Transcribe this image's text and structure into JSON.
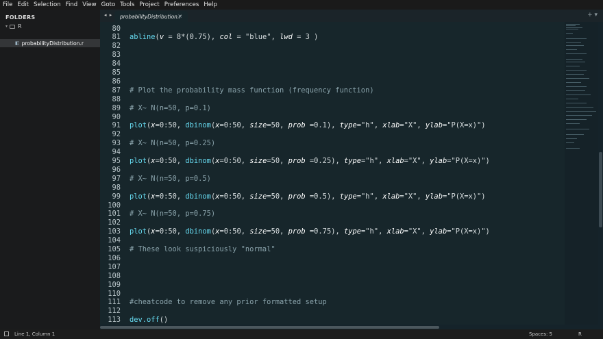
{
  "menu": [
    "File",
    "Edit",
    "Selection",
    "Find",
    "View",
    "Goto",
    "Tools",
    "Project",
    "Preferences",
    "Help"
  ],
  "sidebar": {
    "title": "FOLDERS",
    "folder": {
      "arrow": "▾",
      "name": "R"
    },
    "file": {
      "glyph": "◧",
      "name": "probabilityDistribution.r"
    }
  },
  "tabbar": {
    "nav": "◂ ▸",
    "tab_label": "probabilityDistribution.r",
    "close": "×",
    "actions": "+ ▾"
  },
  "editor": {
    "lines": [
      {
        "n": "80",
        "segs": []
      },
      {
        "n": "81",
        "segs": [
          [
            "fn",
            "abline"
          ],
          [
            "op",
            "("
          ],
          [
            "arg",
            "v"
          ],
          [
            "op",
            " = "
          ],
          [
            "num",
            "8"
          ],
          [
            "op",
            "*("
          ],
          [
            "num",
            "0.75"
          ],
          [
            "op",
            "), "
          ],
          [
            "arg",
            "col"
          ],
          [
            "op",
            " = "
          ],
          [
            "str",
            "\"blue\""
          ],
          [
            "op",
            ", "
          ],
          [
            "arg",
            "lwd"
          ],
          [
            "op",
            " = "
          ],
          [
            "num",
            "3"
          ],
          [
            "op",
            " )"
          ]
        ]
      },
      {
        "n": "82",
        "segs": []
      },
      {
        "n": "83",
        "segs": []
      },
      {
        "n": "84",
        "segs": []
      },
      {
        "n": "85",
        "segs": []
      },
      {
        "n": "86",
        "segs": []
      },
      {
        "n": "87",
        "segs": [
          [
            "cm",
            "# Plot the probability mass function (frequency function)"
          ]
        ]
      },
      {
        "n": "88",
        "segs": []
      },
      {
        "n": "89",
        "segs": [
          [
            "cm",
            "# X~ N(n=50, p=0.1)"
          ]
        ]
      },
      {
        "n": "90",
        "segs": []
      },
      {
        "n": "91",
        "segs": [
          [
            "fn",
            "plot"
          ],
          [
            "op",
            "("
          ],
          [
            "arg",
            "x"
          ],
          [
            "op",
            "="
          ],
          [
            "num",
            "0"
          ],
          [
            "op",
            ":"
          ],
          [
            "num",
            "50"
          ],
          [
            "op",
            ", "
          ],
          [
            "fn",
            "dbinom"
          ],
          [
            "op",
            "("
          ],
          [
            "arg",
            "x"
          ],
          [
            "op",
            "="
          ],
          [
            "num",
            "0"
          ],
          [
            "op",
            ":"
          ],
          [
            "num",
            "50"
          ],
          [
            "op",
            ", "
          ],
          [
            "arg",
            "size"
          ],
          [
            "op",
            "="
          ],
          [
            "num",
            "50"
          ],
          [
            "op",
            ", "
          ],
          [
            "arg",
            "prob"
          ],
          [
            "op",
            " ="
          ],
          [
            "num",
            "0.1"
          ],
          [
            "op",
            "), "
          ],
          [
            "arg",
            "type"
          ],
          [
            "op",
            "="
          ],
          [
            "str",
            "\"h\""
          ],
          [
            "op",
            ", "
          ],
          [
            "arg",
            "xlab"
          ],
          [
            "op",
            "="
          ],
          [
            "str",
            "\"X\""
          ],
          [
            "op",
            ", "
          ],
          [
            "arg",
            "ylab"
          ],
          [
            "op",
            "="
          ],
          [
            "str",
            "\"P(X=x)\""
          ],
          [
            "op",
            ")"
          ]
        ]
      },
      {
        "n": "92",
        "segs": []
      },
      {
        "n": "93",
        "segs": [
          [
            "cm",
            "# X~ N(n=50, p=0.25)"
          ]
        ]
      },
      {
        "n": "94",
        "segs": []
      },
      {
        "n": "95",
        "segs": [
          [
            "fn",
            "plot"
          ],
          [
            "op",
            "("
          ],
          [
            "arg",
            "x"
          ],
          [
            "op",
            "="
          ],
          [
            "num",
            "0"
          ],
          [
            "op",
            ":"
          ],
          [
            "num",
            "50"
          ],
          [
            "op",
            ", "
          ],
          [
            "fn",
            "dbinom"
          ],
          [
            "op",
            "("
          ],
          [
            "arg",
            "x"
          ],
          [
            "op",
            "="
          ],
          [
            "num",
            "0"
          ],
          [
            "op",
            ":"
          ],
          [
            "num",
            "50"
          ],
          [
            "op",
            ", "
          ],
          [
            "arg",
            "size"
          ],
          [
            "op",
            "="
          ],
          [
            "num",
            "50"
          ],
          [
            "op",
            ", "
          ],
          [
            "arg",
            "prob"
          ],
          [
            "op",
            " ="
          ],
          [
            "num",
            "0.25"
          ],
          [
            "op",
            "), "
          ],
          [
            "arg",
            "type"
          ],
          [
            "op",
            "="
          ],
          [
            "str",
            "\"h\""
          ],
          [
            "op",
            ", "
          ],
          [
            "arg",
            "xlab"
          ],
          [
            "op",
            "="
          ],
          [
            "str",
            "\"X\""
          ],
          [
            "op",
            ", "
          ],
          [
            "arg",
            "ylab"
          ],
          [
            "op",
            "="
          ],
          [
            "str",
            "\"P(X=x)\""
          ],
          [
            "op",
            ")"
          ]
        ]
      },
      {
        "n": "96",
        "segs": []
      },
      {
        "n": "97",
        "segs": [
          [
            "cm",
            "# X~ N(n=50, p=0.5)"
          ]
        ]
      },
      {
        "n": "98",
        "segs": []
      },
      {
        "n": "99",
        "segs": [
          [
            "fn",
            "plot"
          ],
          [
            "op",
            "("
          ],
          [
            "arg",
            "x"
          ],
          [
            "op",
            "="
          ],
          [
            "num",
            "0"
          ],
          [
            "op",
            ":"
          ],
          [
            "num",
            "50"
          ],
          [
            "op",
            ", "
          ],
          [
            "fn",
            "dbinom"
          ],
          [
            "op",
            "("
          ],
          [
            "arg",
            "x"
          ],
          [
            "op",
            "="
          ],
          [
            "num",
            "0"
          ],
          [
            "op",
            ":"
          ],
          [
            "num",
            "50"
          ],
          [
            "op",
            ", "
          ],
          [
            "arg",
            "size"
          ],
          [
            "op",
            "="
          ],
          [
            "num",
            "50"
          ],
          [
            "op",
            ", "
          ],
          [
            "arg",
            "prob"
          ],
          [
            "op",
            " ="
          ],
          [
            "num",
            "0.5"
          ],
          [
            "op",
            "), "
          ],
          [
            "arg",
            "type"
          ],
          [
            "op",
            "="
          ],
          [
            "str",
            "\"h\""
          ],
          [
            "op",
            ", "
          ],
          [
            "arg",
            "xlab"
          ],
          [
            "op",
            "="
          ],
          [
            "str",
            "\"X\""
          ],
          [
            "op",
            ", "
          ],
          [
            "arg",
            "ylab"
          ],
          [
            "op",
            "="
          ],
          [
            "str",
            "\"P(X=x)\""
          ],
          [
            "op",
            ")"
          ]
        ]
      },
      {
        "n": "100",
        "segs": []
      },
      {
        "n": "101",
        "segs": [
          [
            "cm",
            "# X~ N(n=50, p=0.75)"
          ]
        ]
      },
      {
        "n": "102",
        "segs": []
      },
      {
        "n": "103",
        "segs": [
          [
            "fn",
            "plot"
          ],
          [
            "op",
            "("
          ],
          [
            "arg",
            "x"
          ],
          [
            "op",
            "="
          ],
          [
            "num",
            "0"
          ],
          [
            "op",
            ":"
          ],
          [
            "num",
            "50"
          ],
          [
            "op",
            ", "
          ],
          [
            "fn",
            "dbinom"
          ],
          [
            "op",
            "("
          ],
          [
            "arg",
            "x"
          ],
          [
            "op",
            "="
          ],
          [
            "num",
            "0"
          ],
          [
            "op",
            ":"
          ],
          [
            "num",
            "50"
          ],
          [
            "op",
            ", "
          ],
          [
            "arg",
            "size"
          ],
          [
            "op",
            "="
          ],
          [
            "num",
            "50"
          ],
          [
            "op",
            ", "
          ],
          [
            "arg",
            "prob"
          ],
          [
            "op",
            " ="
          ],
          [
            "num",
            "0.75"
          ],
          [
            "op",
            "), "
          ],
          [
            "arg",
            "type"
          ],
          [
            "op",
            "="
          ],
          [
            "str",
            "\"h\""
          ],
          [
            "op",
            ", "
          ],
          [
            "arg",
            "xlab"
          ],
          [
            "op",
            "="
          ],
          [
            "str",
            "\"X\""
          ],
          [
            "op",
            ", "
          ],
          [
            "arg",
            "ylab"
          ],
          [
            "op",
            "="
          ],
          [
            "str",
            "\"P(X=x)\""
          ],
          [
            "op",
            ")"
          ]
        ]
      },
      {
        "n": "104",
        "segs": []
      },
      {
        "n": "105",
        "segs": [
          [
            "cm",
            "# These look suspiciously \"normal\""
          ]
        ]
      },
      {
        "n": "106",
        "segs": []
      },
      {
        "n": "107",
        "segs": []
      },
      {
        "n": "108",
        "segs": []
      },
      {
        "n": "109",
        "segs": []
      },
      {
        "n": "110",
        "segs": []
      },
      {
        "n": "111",
        "segs": [
          [
            "cm",
            "#cheatcode to remove any prior formatted setup"
          ]
        ]
      },
      {
        "n": "112",
        "segs": []
      },
      {
        "n": "113",
        "segs": [
          [
            "fn",
            "dev.off"
          ],
          [
            "op",
            "()"
          ]
        ]
      }
    ]
  },
  "statusbar": {
    "cursor": "Line 1, Column 1",
    "indent": "Spaces: 5",
    "syntax": "R"
  },
  "colors": {
    "editor_bg": "#17262b",
    "function": "#66d9ef",
    "comment": "#8aa3ab",
    "argument": "#ffffff"
  }
}
